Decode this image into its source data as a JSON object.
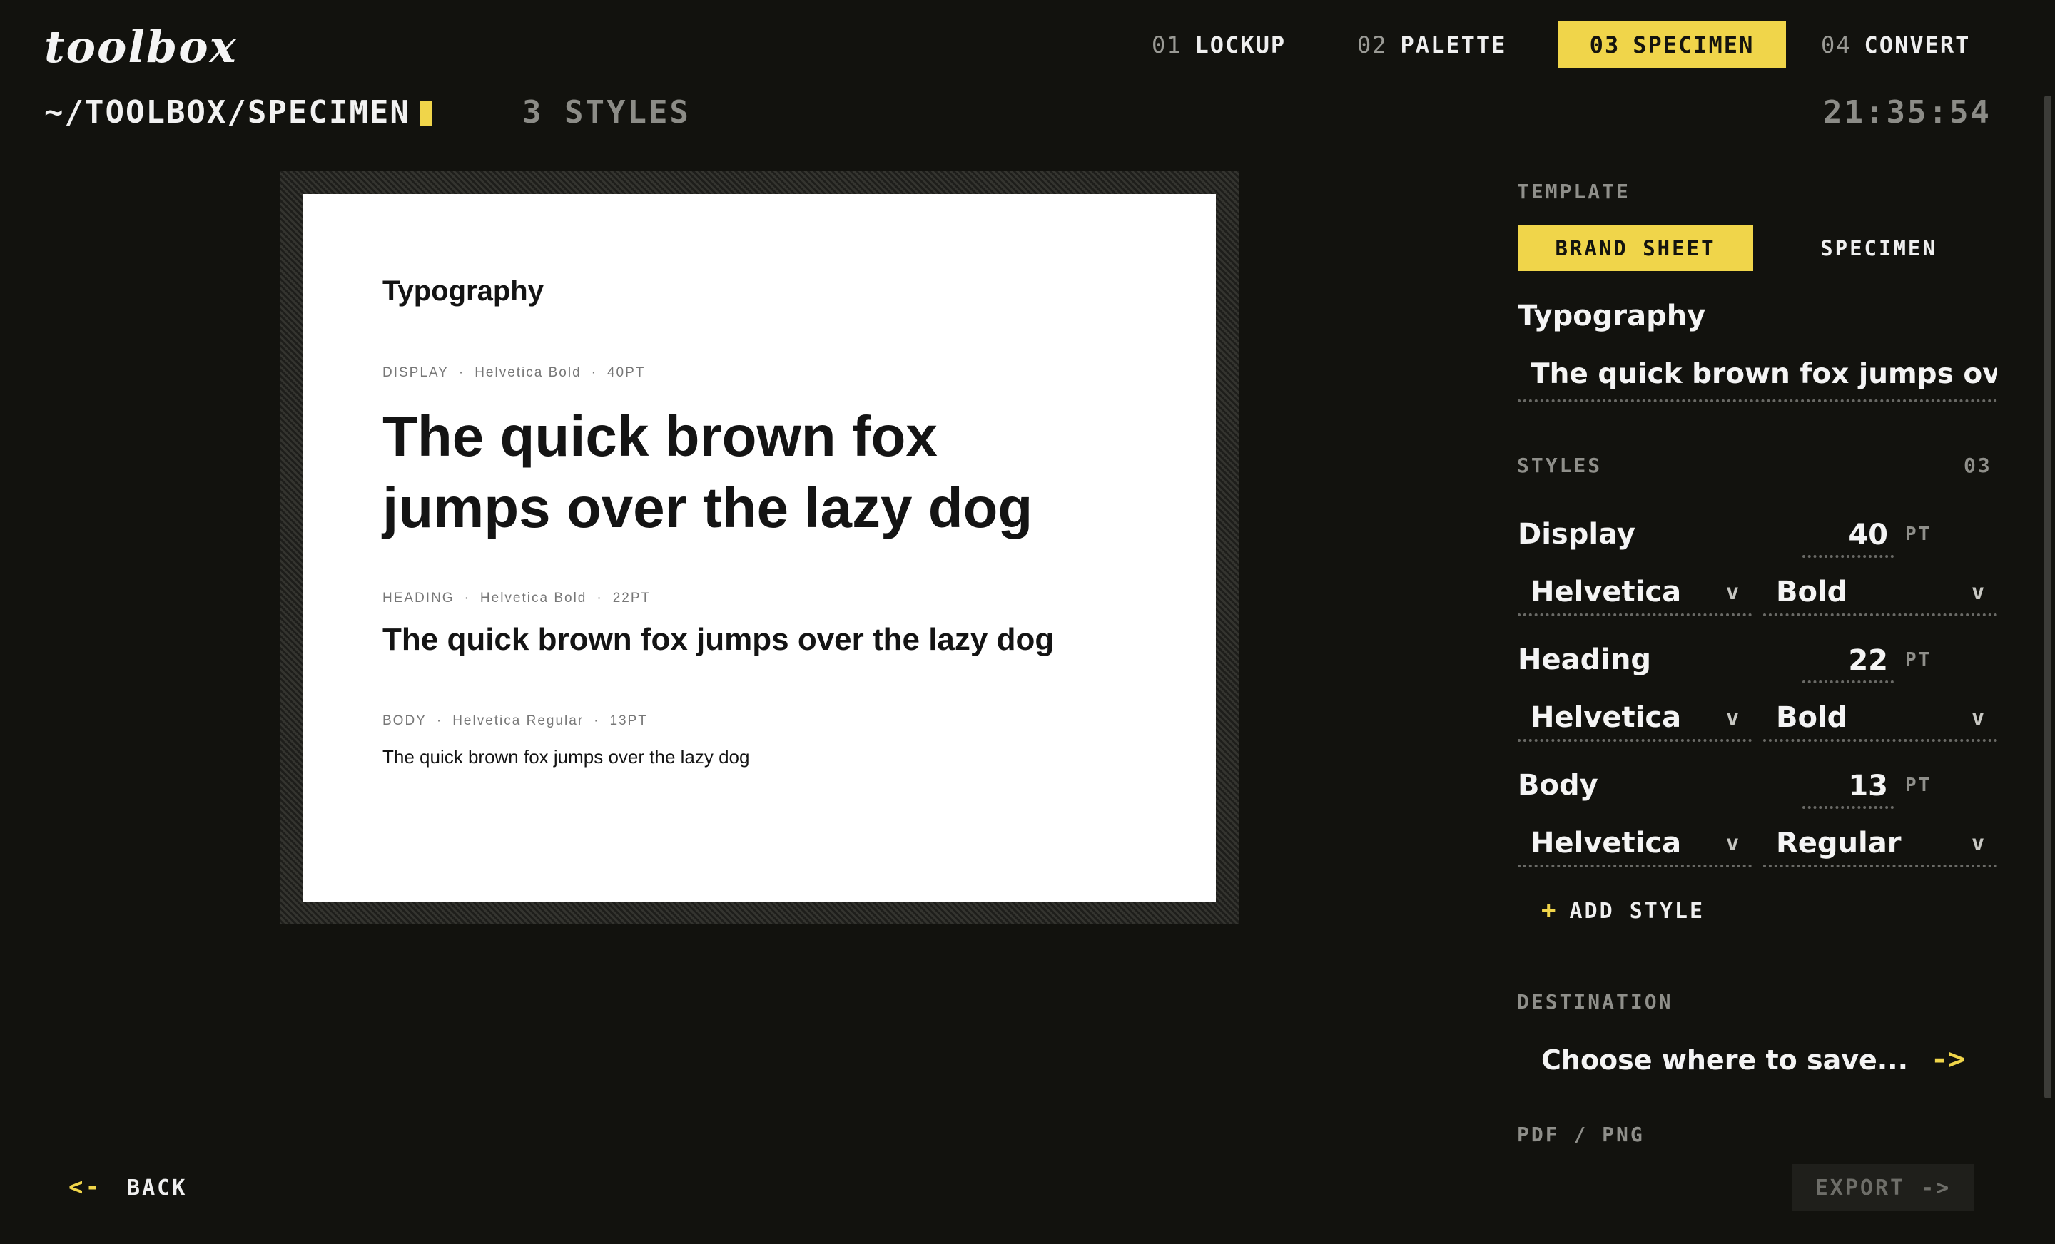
{
  "app": {
    "logo": "toolbox"
  },
  "nav": [
    {
      "num": "01",
      "label": "LOCKUP"
    },
    {
      "num": "02",
      "label": "PALETTE"
    },
    {
      "num": "03",
      "label": "SPECIMEN"
    },
    {
      "num": "04",
      "label": "CONVERT"
    }
  ],
  "nav_active": "03 SPECIMEN",
  "breadcrumb": {
    "path": "~/TOOLBOX/SPECIMEN",
    "count": "3 STYLES",
    "time": "21:35:54"
  },
  "preview": {
    "title": "Typography",
    "display": {
      "tag": "DISPLAY",
      "font": "Helvetica Bold",
      "size": "40PT",
      "text": "The quick brown fox jumps over the lazy dog"
    },
    "heading": {
      "tag": "HEADING",
      "font": "Helvetica Bold",
      "size": "22PT",
      "text": "The quick brown fox jumps over the lazy dog"
    },
    "body": {
      "tag": "BODY",
      "font": "Helvetica Regular",
      "size": "13PT",
      "text": "The quick brown fox jumps over the lazy dog"
    },
    "separator": "·"
  },
  "sidebar": {
    "template_label": "TEMPLATE",
    "template_options": [
      "BRAND SHEET",
      "SPECIMEN"
    ],
    "template_selected": "BRAND SHEET",
    "title_value": "Typography",
    "sample_text": "The quick brown fox jumps over",
    "styles_label": "STYLES",
    "styles_count": "03",
    "unit": "PT",
    "styles": [
      {
        "name": "Display",
        "size": "40",
        "family": "Helvetica",
        "weight": "Bold"
      },
      {
        "name": "Heading",
        "size": "22",
        "family": "Helvetica",
        "weight": "Bold"
      },
      {
        "name": "Body",
        "size": "13",
        "family": "Helvetica",
        "weight": "Regular"
      }
    ],
    "add_style": "ADD STYLE",
    "destination_label": "DESTINATION",
    "destination_placeholder": "Choose where to save...",
    "format_label": "PDF / PNG"
  },
  "footer": {
    "back": "BACK",
    "export": "EXPORT"
  },
  "colors": {
    "accent": "#f0d54a",
    "background": "#12120e",
    "muted": "#8f8f8a"
  }
}
